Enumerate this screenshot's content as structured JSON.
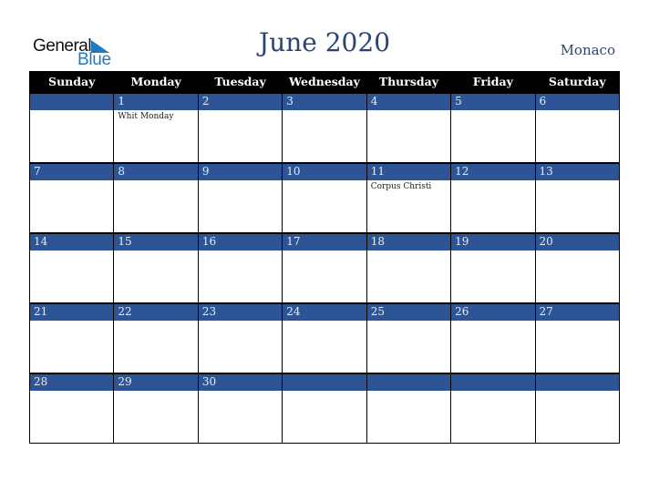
{
  "logo": {
    "line1": "General",
    "line2": "Blue",
    "icon": "triangle-icon"
  },
  "header": {
    "title": "June 2020",
    "country": "Monaco"
  },
  "colors": {
    "header_bg": "#000000",
    "band_bg": "#2d5595",
    "title": "#2b4573",
    "logo_blue": "#1f7bc1"
  },
  "weekdays": [
    "Sunday",
    "Monday",
    "Tuesday",
    "Wednesday",
    "Thursday",
    "Friday",
    "Saturday"
  ],
  "weeks": [
    {
      "days": [
        "",
        "1",
        "2",
        "3",
        "4",
        "5",
        "6"
      ],
      "holidays": [
        "",
        "Whit Monday",
        "",
        "",
        "",
        "",
        ""
      ]
    },
    {
      "days": [
        "7",
        "8",
        "9",
        "10",
        "11",
        "12",
        "13"
      ],
      "holidays": [
        "",
        "",
        "",
        "",
        "Corpus Christi",
        "",
        ""
      ]
    },
    {
      "days": [
        "14",
        "15",
        "16",
        "17",
        "18",
        "19",
        "20"
      ],
      "holidays": [
        "",
        "",
        "",
        "",
        "",
        "",
        ""
      ]
    },
    {
      "days": [
        "21",
        "22",
        "23",
        "24",
        "25",
        "26",
        "27"
      ],
      "holidays": [
        "",
        "",
        "",
        "",
        "",
        "",
        ""
      ]
    },
    {
      "days": [
        "28",
        "29",
        "30",
        "",
        "",
        "",
        ""
      ],
      "holidays": [
        "",
        "",
        "",
        "",
        "",
        "",
        ""
      ]
    }
  ]
}
